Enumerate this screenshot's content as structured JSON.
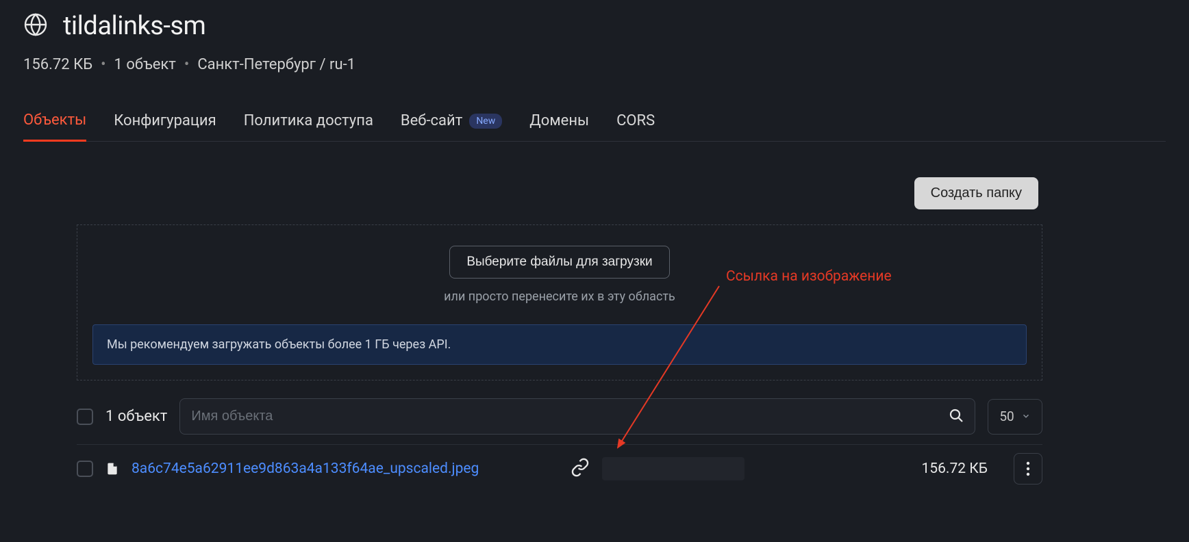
{
  "header": {
    "title": "tildalinks-sm"
  },
  "meta": {
    "size": "156.72 КБ",
    "objects": "1 объект",
    "region": "Санкт-Петербург / ru-1"
  },
  "tabs": {
    "objects": "Объекты",
    "config": "Конфигурация",
    "policy": "Политика доступа",
    "website": "Веб-сайт",
    "website_badge": "New",
    "domains": "Домены",
    "cors": "CORS"
  },
  "actions": {
    "create_folder": "Создать папку"
  },
  "upload": {
    "select_button": "Выберите файлы для загрузки",
    "hint": "или просто перенесите их в эту область",
    "info": "Мы рекомендуем загружать объекты более 1 ГБ через API."
  },
  "list": {
    "count": "1 объект",
    "search_placeholder": "Имя объекта",
    "page_size": "50"
  },
  "files": [
    {
      "name": "8a6c74e5a62911ee9d863a4a133f64ae_upscaled.jpeg",
      "size": "156.72 КБ"
    }
  ],
  "annotation": {
    "label": "Ссылка на изображение"
  }
}
